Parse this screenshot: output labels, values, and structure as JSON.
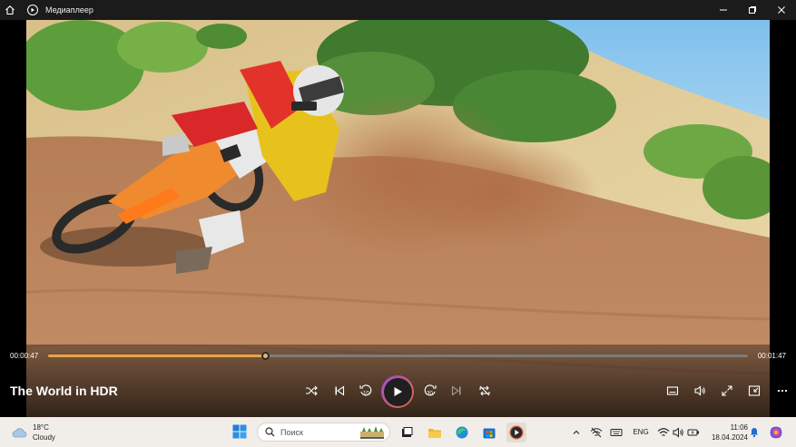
{
  "window": {
    "title": "Медиаплеер",
    "icons": [
      "home-icon",
      "media-player-logo",
      "minimize-icon",
      "maximize-icon",
      "close-icon"
    ]
  },
  "player": {
    "current_time": "00:00:47",
    "duration": "00:01:47",
    "progress_fraction": 0.31,
    "media_title": "The World in HDR",
    "rewind_label": "10",
    "forward_label": "30",
    "controls": [
      "shuffle-icon",
      "previous-icon",
      "rewind-10-icon",
      "play-icon",
      "forward-30-icon",
      "next-icon",
      "repeat-icon",
      "subtitles-icon",
      "volume-icon",
      "fullscreen-icon",
      "mini-player-icon",
      "more-icon"
    ],
    "accent_color": "#e8a14a"
  },
  "taskbar": {
    "weather_temp": "18°C",
    "weather_desc": "Cloudy",
    "search_placeholder": "Поиск",
    "language": "ENG",
    "time": "11:06",
    "date": "18.04.2024",
    "apps": [
      "start-icon",
      "task-view-icon",
      "file-explorer-icon",
      "edge-icon",
      "store-icon",
      "media-player-icon"
    ],
    "tray": [
      "chevron-up-icon",
      "network-off-icon",
      "keyboard-icon",
      "wifi-icon",
      "speaker-icon",
      "battery-icon",
      "bell-icon",
      "copilot-icon"
    ]
  }
}
